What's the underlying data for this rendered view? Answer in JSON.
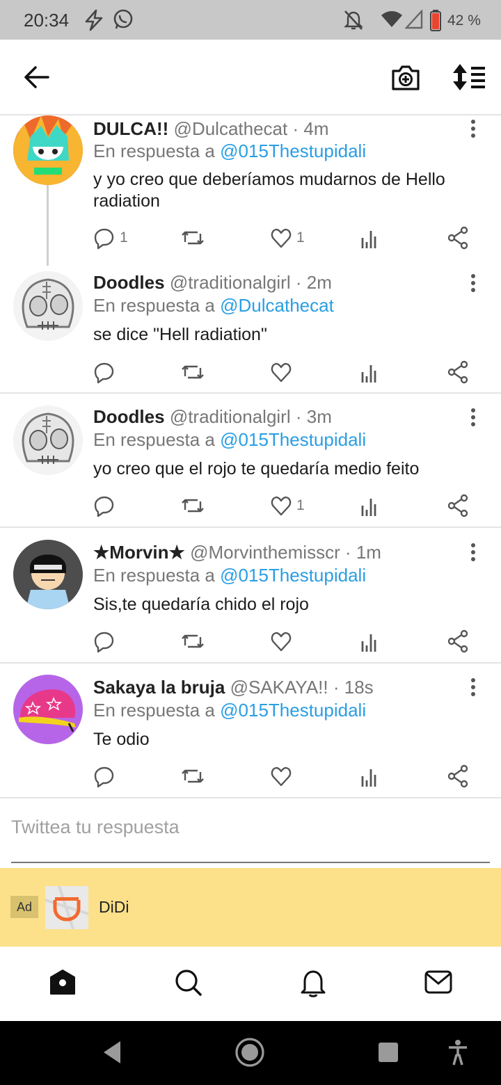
{
  "status_bar": {
    "time": "20:34",
    "battery": "42 %",
    "icons": [
      "flash-icon",
      "whatsapp-icon",
      "mute-icon",
      "wifi-icon",
      "signal-icon",
      "battery-icon"
    ]
  },
  "app_bar": {
    "icons": [
      "back-arrow-icon",
      "add-camera-icon",
      "sort-icon"
    ]
  },
  "tweets": [
    {
      "name": "DULCA!!",
      "handle": "@Dulcathecat",
      "time": "· 4m",
      "reply_prefix": "En respuesta a",
      "reply_to": "@015Thestupidali",
      "text": "y yo creo que deberíamos mudarnos de Hello radiation",
      "replies": "1",
      "likes": "1"
    },
    {
      "name": "Doodles",
      "handle": "@traditionalgirl",
      "time": "· 2m",
      "reply_prefix": "En respuesta a",
      "reply_to": "@Dulcathecat",
      "text": "se dice \"Hell radiation\"",
      "replies": "",
      "likes": ""
    },
    {
      "name": "Doodles",
      "handle": "@traditionalgirl",
      "time": "· 3m",
      "reply_prefix": "En respuesta a",
      "reply_to": "@015Thestupidali",
      "text": "yo creo que el rojo te quedaría medio feito",
      "replies": "",
      "likes": "1"
    },
    {
      "name": "★Morvin★",
      "handle": "@Morvinthemisscr",
      "time": "· 1m",
      "reply_prefix": "En respuesta a",
      "reply_to": "@015Thestupidali",
      "text": "Sis,te quedaría chido el rojo",
      "replies": "",
      "likes": ""
    },
    {
      "name": "Sakaya la bruja",
      "handle": "@SAKAYA!!",
      "time": "· 18s",
      "reply_prefix": "En respuesta a",
      "reply_to": "@015Thestupidali",
      "text": "Te odio",
      "replies": "",
      "likes": ""
    }
  ],
  "compose": {
    "placeholder": "Twittea tu respuesta"
  },
  "ad": {
    "tag": "Ad",
    "name": "DiDi"
  },
  "tab_bar": {
    "icons": [
      "home-icon",
      "search-icon",
      "notifications-icon",
      "messages-icon"
    ]
  },
  "nav_bar": {
    "icons": [
      "nav-back-icon",
      "nav-home-icon",
      "nav-recents-icon",
      "accessibility-icon"
    ]
  },
  "colors": {
    "link": "#2a9ee3",
    "ad_background": "#fde08a",
    "status_bar": "#c8c8c8"
  }
}
